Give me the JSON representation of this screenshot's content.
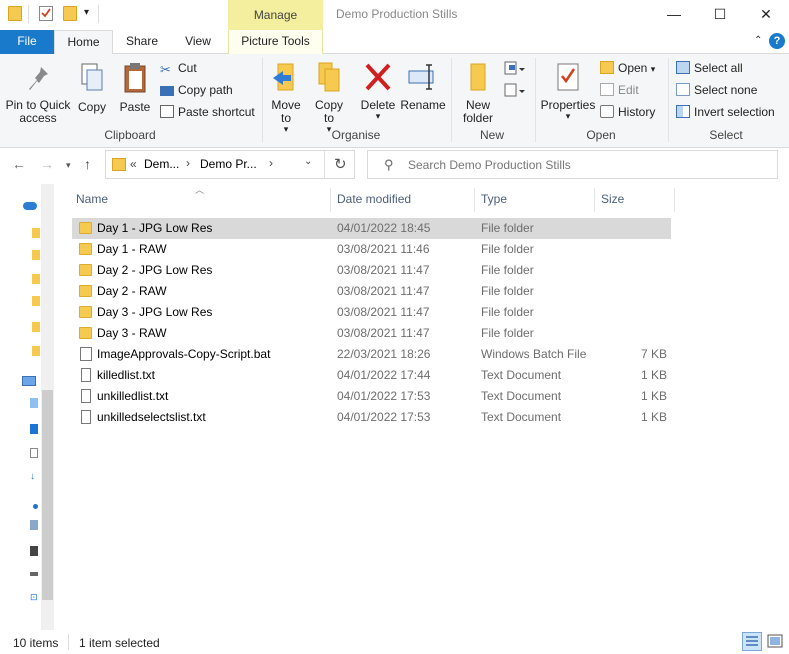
{
  "window": {
    "title": "Demo Production Stills",
    "contextual_tab": "Manage",
    "controls": {
      "minimize": "—",
      "maximize": "☐",
      "close": "✕"
    }
  },
  "ribbon_tabs": [
    "File",
    "Home",
    "Share",
    "View",
    "Picture Tools"
  ],
  "ribbon": {
    "clipboard": {
      "pin_label": "Pin to Quick access",
      "copy_label": "Copy",
      "paste_label": "Paste",
      "cut_label": "Cut",
      "copy_path_label": "Copy path",
      "paste_shortcut_label": "Paste shortcut",
      "group_label": "Clipboard"
    },
    "organise": {
      "move_to_label": "Move to",
      "copy_to_label": "Copy to",
      "delete_label": "Delete",
      "rename_label": "Rename",
      "group_label": "Organise"
    },
    "new": {
      "new_folder_label": "New folder",
      "group_label": "New"
    },
    "open": {
      "properties_label": "Properties",
      "open_label": "Open",
      "edit_label": "Edit",
      "history_label": "History",
      "group_label": "Open"
    },
    "select": {
      "select_all_label": "Select all",
      "select_none_label": "Select none",
      "invert_label": "Invert selection",
      "group_label": "Select"
    }
  },
  "address": {
    "crumb_overflow": "«",
    "crumbs": [
      "Dem...",
      "Demo Pr..."
    ],
    "search_placeholder": "Search Demo Production Stills"
  },
  "columns": {
    "name": "Name",
    "date": "Date modified",
    "type": "Type",
    "size": "Size"
  },
  "files": [
    {
      "name": "Day 1 - JPG Low Res",
      "date": "04/01/2022 18:45",
      "type": "File folder",
      "size": "",
      "icon": "folder-icon",
      "selected": true
    },
    {
      "name": "Day 1 - RAW",
      "date": "03/08/2021 11:46",
      "type": "File folder",
      "size": "",
      "icon": "folder-icon"
    },
    {
      "name": "Day 2 - JPG Low Res",
      "date": "03/08/2021 11:47",
      "type": "File folder",
      "size": "",
      "icon": "folder-icon"
    },
    {
      "name": "Day 2 - RAW",
      "date": "03/08/2021 11:47",
      "type": "File folder",
      "size": "",
      "icon": "folder-icon"
    },
    {
      "name": "Day 3 - JPG Low Res",
      "date": "03/08/2021 11:47",
      "type": "File folder",
      "size": "",
      "icon": "folder-icon"
    },
    {
      "name": "Day 3 - RAW",
      "date": "03/08/2021 11:47",
      "type": "File folder",
      "size": "",
      "icon": "folder-icon"
    },
    {
      "name": "ImageApprovals-Copy-Script.bat",
      "date": "22/03/2021 18:26",
      "type": "Windows Batch File",
      "size": "7 KB",
      "icon": "batch-file-icon"
    },
    {
      "name": "killedlist.txt",
      "date": "04/01/2022 17:44",
      "type": "Text Document",
      "size": "1 KB",
      "icon": "text-file-icon"
    },
    {
      "name": "unkilledlist.txt",
      "date": "04/01/2022 17:53",
      "type": "Text Document",
      "size": "1 KB",
      "icon": "text-file-icon"
    },
    {
      "name": "unkilledselectslist.txt",
      "date": "04/01/2022 17:53",
      "type": "Text Document",
      "size": "1 KB",
      "icon": "text-file-icon"
    }
  ],
  "status": {
    "count": "10 items",
    "selection": "1 item selected"
  },
  "colors": {
    "accent": "#1979ca",
    "manage_tab": "#f4ef9e",
    "folder": "#f6c951",
    "selected_row": "#d9d9d9"
  }
}
